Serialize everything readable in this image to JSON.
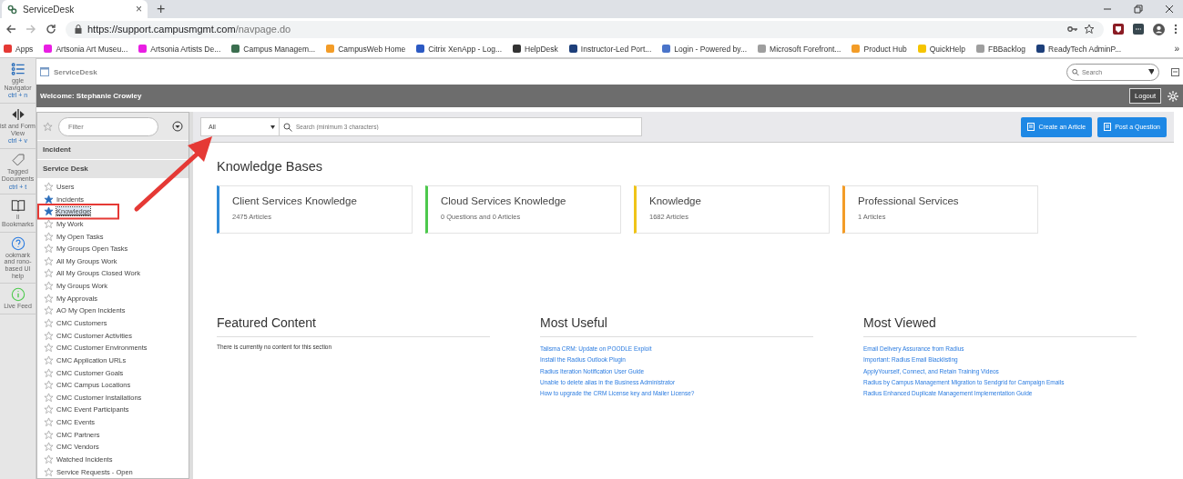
{
  "browser": {
    "tab": {
      "title": "ServiceDesk",
      "close": "×"
    },
    "new_tab": "+",
    "url": {
      "host": "https://support.campusmgmt.com",
      "path": "/navpage.do"
    },
    "bookmarks": [
      {
        "label": "Apps",
        "color": "#e53935"
      },
      {
        "label": "Artsonia Art Museu...",
        "color": "#e91ee3"
      },
      {
        "label": "Artsonia Artists  De...",
        "color": "#e91ee3"
      },
      {
        "label": "Campus Managem...",
        "color": "#3b6e4f"
      },
      {
        "label": "CampusWeb  Home",
        "color": "#f39c27"
      },
      {
        "label": "Citrix XenApp - Log...",
        "color": "#2b59c3"
      },
      {
        "label": "HelpDesk",
        "color": "#333333"
      },
      {
        "label": "Instructor-Led Port...",
        "color": "#1d3f7a"
      },
      {
        "label": "Login - Powered by...",
        "color": "#4a74c9"
      },
      {
        "label": "Microsoft Forefront...",
        "color": "#9e9e9e"
      },
      {
        "label": "Product Hub",
        "color": "#f39c27"
      },
      {
        "label": "QuickHelp",
        "color": "#f5c400"
      },
      {
        "label": "FBBacklog",
        "color": "#9e9e9e"
      },
      {
        "label": "ReadyTech AdminP...",
        "color": "#1d3f7a"
      }
    ],
    "more": "»"
  },
  "rail": [
    {
      "kind": "navigator",
      "label": "ggle Navigator",
      "shortcut": "ctrl + n"
    },
    {
      "kind": "view",
      "label": "ist and Form View",
      "shortcut": "ctrl + v"
    },
    {
      "kind": "tag",
      "label": "Tagged Documents",
      "shortcut": "ctrl + t"
    },
    {
      "kind": "book",
      "label": "ll Bookmarks"
    },
    {
      "kind": "help",
      "label": "ookmark and rono-based UI help"
    },
    {
      "kind": "feed",
      "label": "Live Feed"
    }
  ],
  "app": {
    "title": "ServiceDesk",
    "global_search": {
      "placeholder": "Search"
    },
    "welcome": "Welcome:  Stephanie Crowley",
    "logout": "Logout"
  },
  "sidebar": {
    "filter": {
      "placeholder": "Filter"
    },
    "groups": [
      {
        "label": "Incident"
      },
      {
        "label": "Service Desk"
      }
    ],
    "items": [
      {
        "label": "Users",
        "favorite": false,
        "selected": false
      },
      {
        "label": "Incidents",
        "favorite": true,
        "selected": false
      },
      {
        "label": "Knowledge",
        "favorite": true,
        "selected": true
      },
      {
        "label": "My Work",
        "favorite": false,
        "selected": false
      },
      {
        "label": "My Open Tasks",
        "favorite": false,
        "selected": false
      },
      {
        "label": "My Groups Open Tasks",
        "favorite": false,
        "selected": false
      },
      {
        "label": "All My Groups Work",
        "favorite": false,
        "selected": false
      },
      {
        "label": "All My Groups Closed Work",
        "favorite": false,
        "selected": false
      },
      {
        "label": "My Groups Work",
        "favorite": false,
        "selected": false
      },
      {
        "label": "My Approvals",
        "favorite": false,
        "selected": false
      },
      {
        "label": "AO My Open Incidents",
        "favorite": false,
        "selected": false
      },
      {
        "label": "CMC Customers",
        "favorite": false,
        "selected": false
      },
      {
        "label": "CMC Customer Activities",
        "favorite": false,
        "selected": false
      },
      {
        "label": "CMC Customer Environments",
        "favorite": false,
        "selected": false
      },
      {
        "label": "CMC Application URLs",
        "favorite": false,
        "selected": false
      },
      {
        "label": "CMC Customer Goals",
        "favorite": false,
        "selected": false
      },
      {
        "label": "CMC Campus Locations",
        "favorite": false,
        "selected": false
      },
      {
        "label": "CMC Customer Installations",
        "favorite": false,
        "selected": false
      },
      {
        "label": "CMC Event Participants",
        "favorite": false,
        "selected": false
      },
      {
        "label": "CMC Events",
        "favorite": false,
        "selected": false
      },
      {
        "label": "CMC Partners",
        "favorite": false,
        "selected": false
      },
      {
        "label": "CMC Vendors",
        "favorite": false,
        "selected": false
      },
      {
        "label": "Watched Incidents",
        "favorite": false,
        "selected": false
      },
      {
        "label": "Service Requests - Open",
        "favorite": false,
        "selected": false
      }
    ]
  },
  "toolbar": {
    "scope": "All",
    "search": {
      "placeholder": "Search (minimum 3 characters)"
    },
    "buttons": [
      "Create an Article",
      "Post a Question"
    ]
  },
  "knowledge_bases": {
    "title": "Knowledge Bases",
    "cards": [
      {
        "title": "Client Services Knowledge",
        "count": "2475 Articles",
        "color": "#2e8ad8"
      },
      {
        "title": "Cloud Services Knowledge",
        "count": "0 Questions and  0 Articles",
        "color": "#4cc94c"
      },
      {
        "title": "Knowledge",
        "count": "1682 Articles",
        "color": "#f0c419"
      },
      {
        "title": "Professional Services",
        "count": "1 Articles",
        "color": "#f39c27"
      }
    ]
  },
  "sections": [
    {
      "title": "Featured Content",
      "text": "There is currently no content for this section"
    },
    {
      "title": "Most Useful",
      "links": [
        "Talisma CRM: Update on POODLE Exploit",
        "Install the Radius Outlook Plugin",
        "Radius Iteration Notification User Guide",
        "Unable to delete alias in the Business Administrator",
        "How to upgrade the CRM License key and Mailer License?"
      ]
    },
    {
      "title": "Most Viewed",
      "links": [
        "Email Delivery Assurance from Radius",
        "Important: Radius Email Blacklisting",
        "ApplyYourself, Connect, and Retain Training Videos",
        "Radius by Campus Management Migration to Sendgrid for Campaign Emails",
        "Radius Enhanced Duplicate Management Implementation Guide"
      ]
    }
  ]
}
